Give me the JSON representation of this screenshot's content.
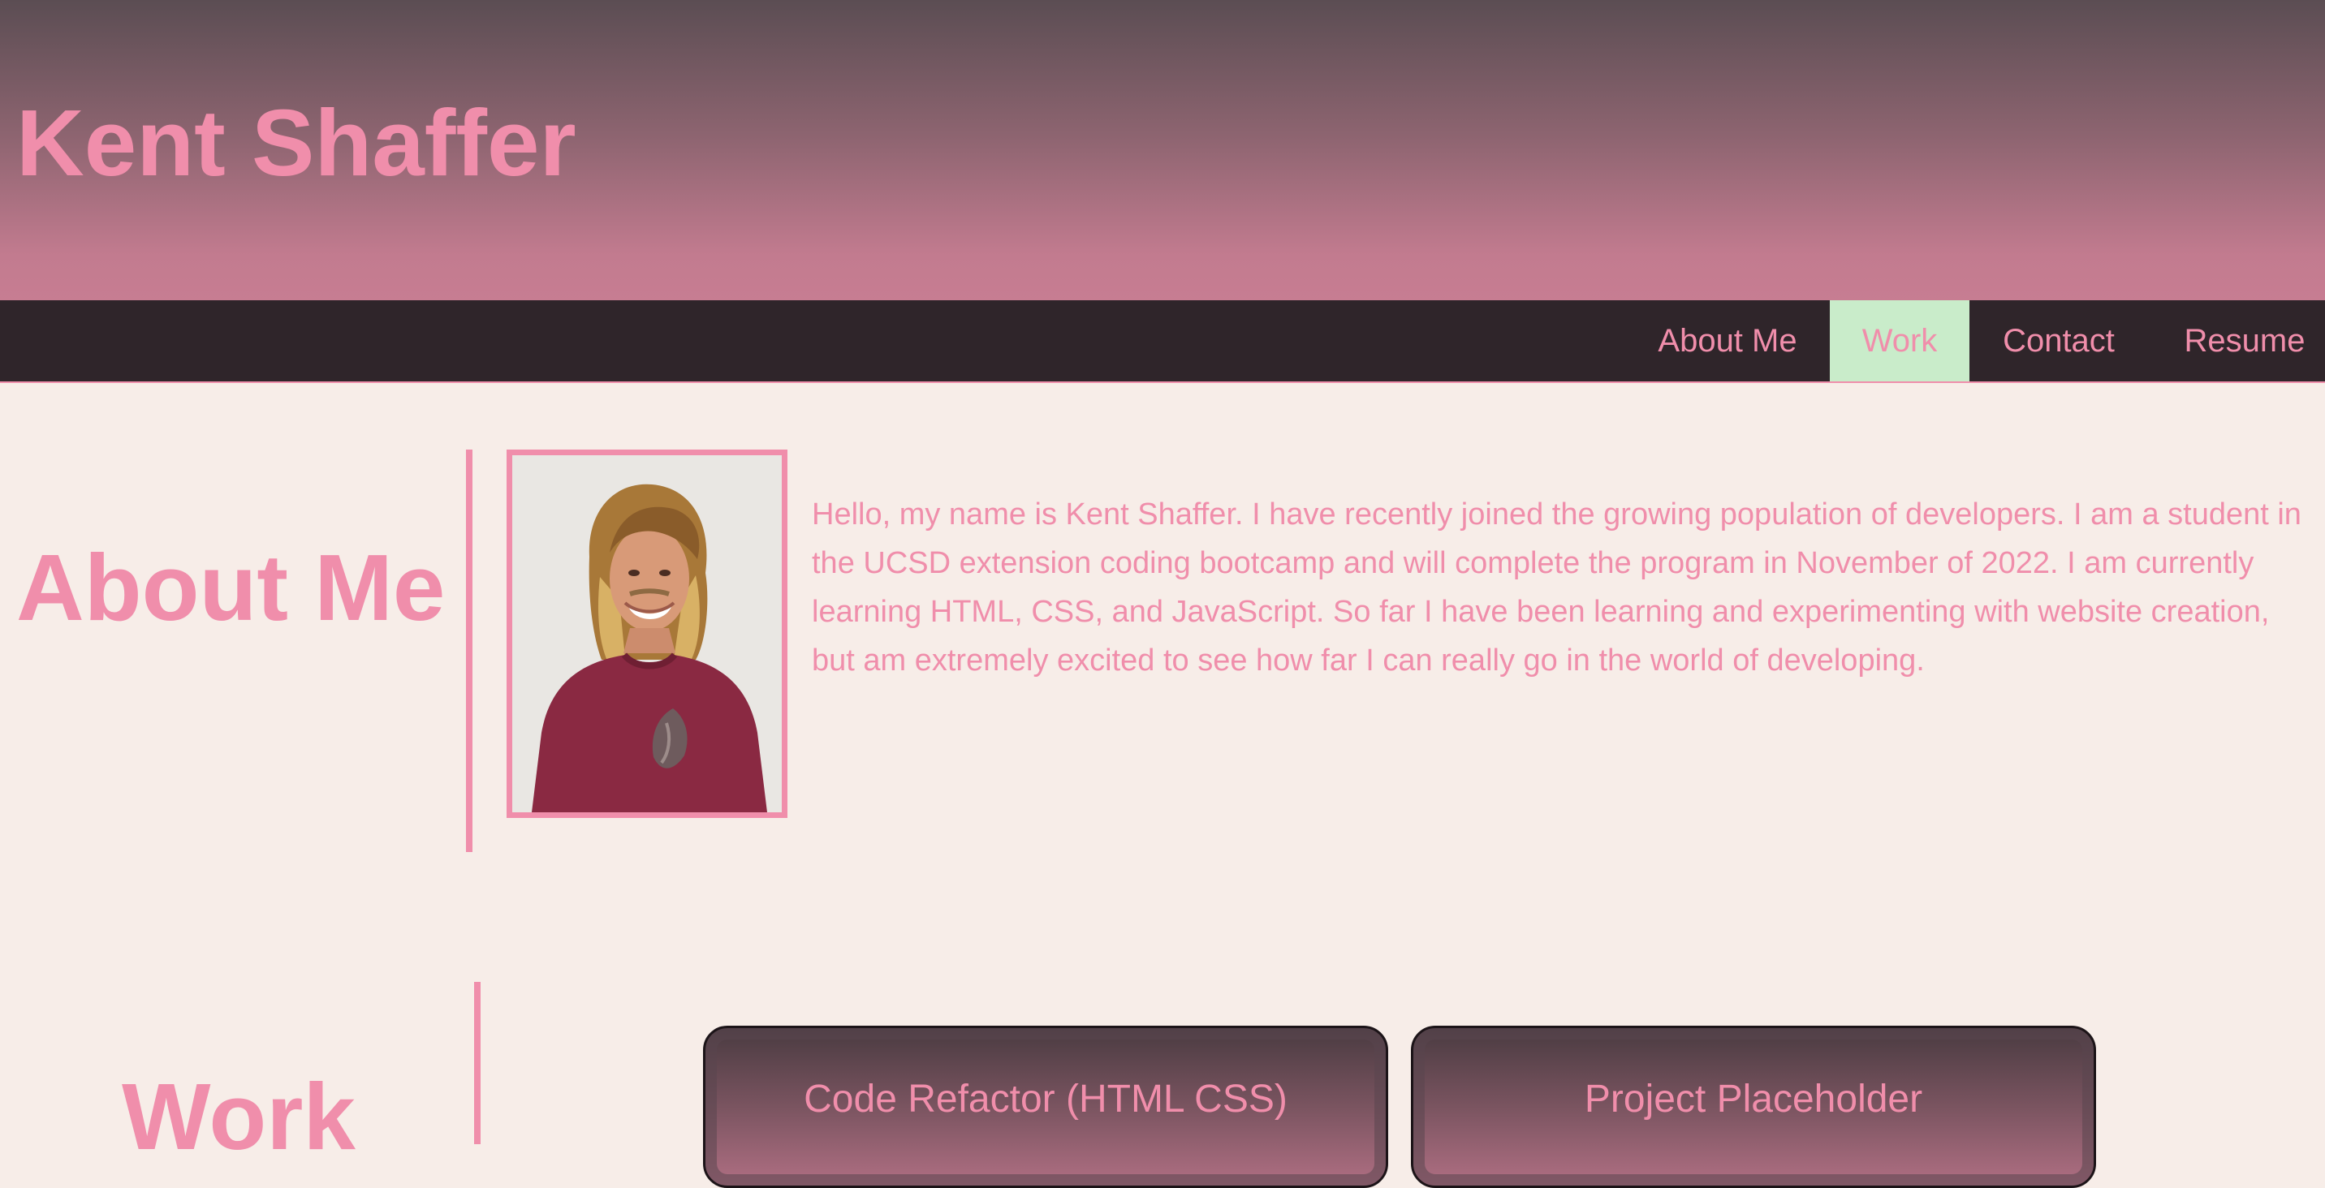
{
  "header": {
    "title": "Kent Shaffer"
  },
  "nav": {
    "items": [
      {
        "label": "About Me",
        "active": false
      },
      {
        "label": "Work",
        "active": true
      },
      {
        "label": "Contact",
        "active": false
      },
      {
        "label": "Resume",
        "active": false
      }
    ]
  },
  "about": {
    "heading": "About Me",
    "portrait_alt": "portrait-photo",
    "text": "Hello, my name is Kent Shaffer. I have recently joined the growing population of developers. I am a student in the UCSD extension coding bootcamp and will complete the program in November of 2022. I am currently learning HTML, CSS, and JavaScript. So far I have been learning and experimenting with website creation, but am extremely excited to see how far I can really go in the world of developing."
  },
  "work": {
    "heading": "Work",
    "cards": [
      {
        "title": "Code Refactor (HTML CSS)"
      },
      {
        "title": "Project Placeholder"
      }
    ]
  },
  "colors": {
    "accent_pink": "#f08eab",
    "nav_background": "#2f252a",
    "active_nav_background": "#c9ecca",
    "page_background": "#f7ede8",
    "header_gradient_top": "#5b4d53",
    "header_gradient_bottom": "#c77d92"
  }
}
